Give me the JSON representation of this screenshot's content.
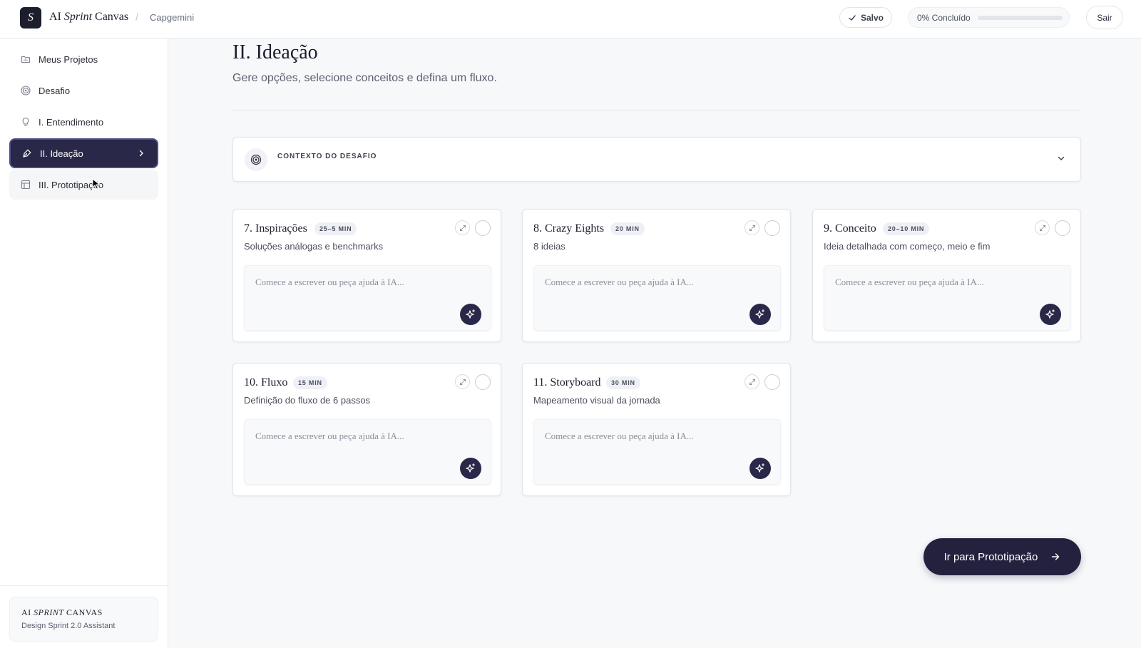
{
  "header": {
    "logo_letter": "S",
    "app_title_prefix": "AI ",
    "app_title_italic": "Sprint",
    "app_title_suffix": " Canvas",
    "separator": "/",
    "breadcrumb": "Capgemini",
    "saved_label": "Salvo",
    "progress_label": "0% Concluído",
    "progress_value": 0,
    "logout_label": "Sair"
  },
  "sidebar": {
    "items": [
      {
        "label": "Meus Projetos",
        "icon": "folder-icon"
      },
      {
        "label": "Desafio",
        "icon": "target-icon"
      },
      {
        "label": "I. Entendimento",
        "icon": "lightbulb-icon"
      },
      {
        "label": "II. Ideação",
        "icon": "pen-tool-icon",
        "active": true
      },
      {
        "label": "III. Prototipação",
        "icon": "layout-icon"
      }
    ],
    "footer_title_prefix": "AI ",
    "footer_title_italic": "SPRINT",
    "footer_title_suffix": " CANVAS",
    "footer_subtitle": "Design Sprint 2.0 Assistant"
  },
  "main": {
    "title": "II. Ideação",
    "subtitle": "Gere opções, selecione conceitos e defina um fluxo.",
    "context_label": "CONTEXTO DO DESAFIO",
    "cards": [
      {
        "title": "7. Inspirações",
        "badge": "25–5 MIN",
        "desc": "Soluções análogas e benchmarks",
        "placeholder": "Comece a escrever ou peça ajuda à IA..."
      },
      {
        "title": "8. Crazy Eights",
        "badge": "20 MIN",
        "desc": "8 ideias",
        "placeholder": "Comece a escrever ou peça ajuda à IA..."
      },
      {
        "title": "9. Conceito",
        "badge": "20–10 MIN",
        "desc": "Ideia detalhada com começo, meio e fim",
        "placeholder": "Comece a escrever ou peça ajuda à IA..."
      },
      {
        "title": "10. Fluxo",
        "badge": "15 MIN",
        "desc": "Definição do fluxo de 6 passos",
        "placeholder": "Comece a escrever ou peça ajuda à IA..."
      },
      {
        "title": "11. Storyboard",
        "badge": "30 MIN",
        "desc": "Mapeamento visual da jornada",
        "placeholder": "Comece a escrever ou peça ajuda à IA..."
      }
    ],
    "cta_label": "Ir para Prototipação"
  },
  "colors": {
    "primary": "#2a2848",
    "background": "#f7f8fa",
    "border": "#e2e4e9"
  }
}
